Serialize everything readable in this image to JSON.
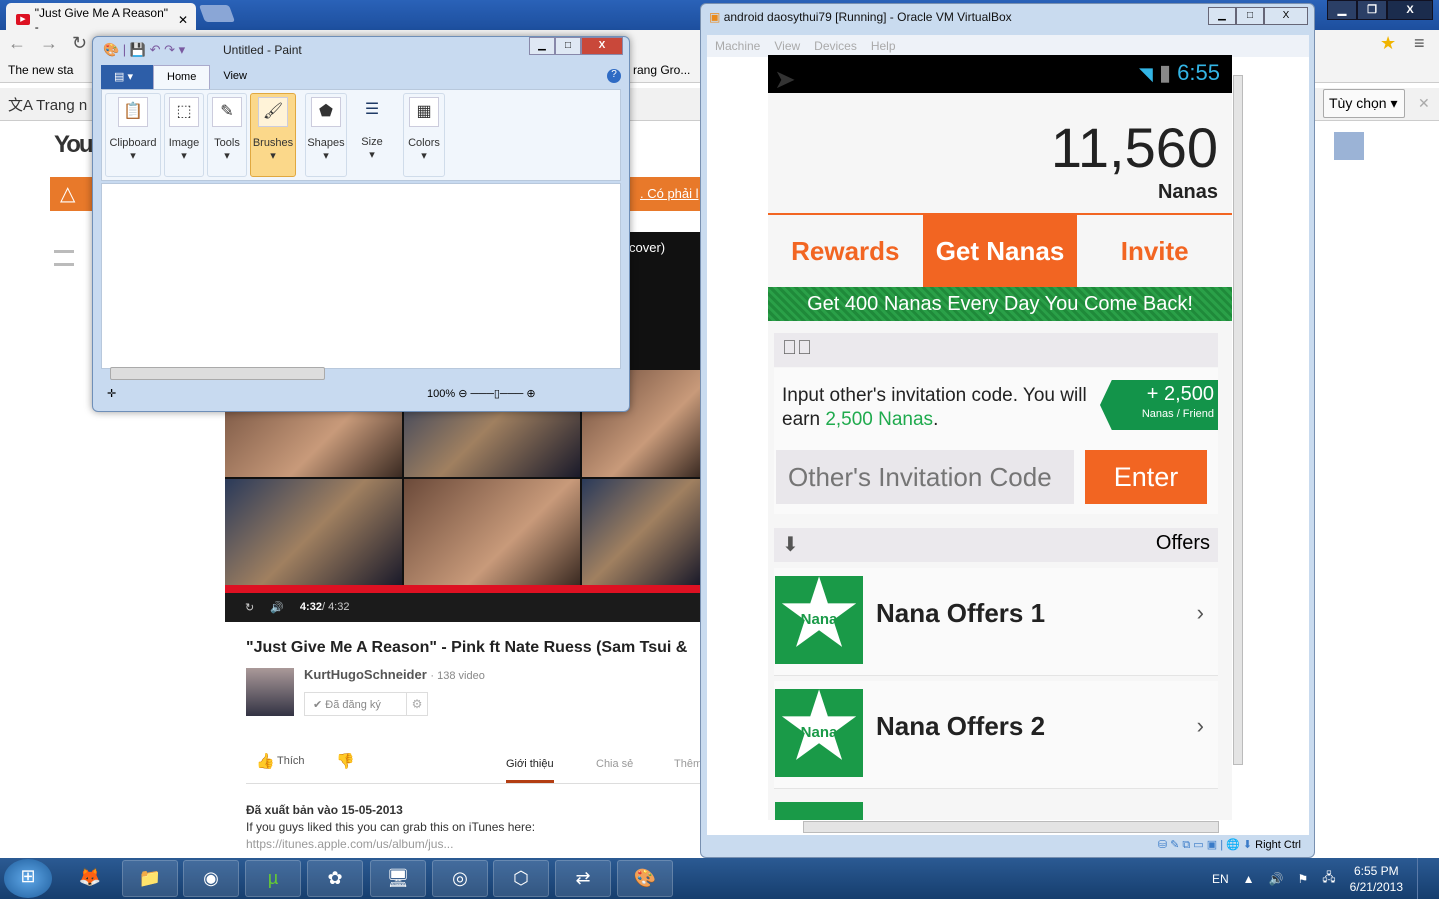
{
  "chrome": {
    "tab_title": "\"Just Give Me A Reason\" -",
    "bookmark": "The new sta",
    "bookmark_right": "rang Gro...",
    "translate_text": "Trang n",
    "translate_options": "Tùy chọn ▾",
    "page_banner_link": ". Có phải l",
    "window_buttons": [
      "▁",
      "❐",
      "X"
    ]
  },
  "youtube": {
    "logo": "You",
    "player_label": "cover)",
    "time_current": "4:32",
    "time_total": "/ 4:32",
    "video_title": "\"Just Give Me A Reason\" - Pink ft Nate Ruess (Sam Tsui &",
    "channel": "KurtHugoSchneider",
    "video_count": "· 138 video",
    "subscribed": "✔  Đã đăng ký",
    "like": "Thích",
    "tabs": [
      "Giới thiệu",
      "Chia sẻ",
      "Thêm"
    ],
    "published": "Đã xuất bản vào 15-05-2013",
    "desc_line": "If you guys liked this you can grab this on iTunes here:",
    "desc_link": "https://itunes.apple.com/us/album/jus..."
  },
  "paint": {
    "title": "Untitled - Paint",
    "tabs": [
      "Home",
      "View"
    ],
    "groups": [
      "Clipboard",
      "Image",
      "Tools",
      "Brushes",
      "Shapes",
      "Size",
      "Colors"
    ],
    "zoom": "100%"
  },
  "vbox": {
    "title": "android daosythui79 [Running] - Oracle VM VirtualBox",
    "menu": [
      "Machine",
      "View",
      "Devices",
      "Help"
    ],
    "host_key": "Right Ctrl"
  },
  "android": {
    "time": "6:55",
    "balance": "11,560",
    "unit": "Nanas",
    "tabs": [
      "Rewards",
      "Get Nanas",
      "Invite"
    ],
    "active_tab": "Get Nanas",
    "banner": "Get 400 Nanas Every Day You Come Back!",
    "invite_text": "Input other's invitation code. You will earn ",
    "invite_amount": "2,500 Nanas",
    "badge_amount": "+ 2,500",
    "badge_sub": "Nanas / Friend",
    "code_placeholder": "Other's Invitation Code",
    "enter": "Enter",
    "offers_header": "Offers",
    "star_label": "Nana",
    "offers": [
      "Nana Offers 1",
      "Nana Offers 2"
    ]
  },
  "taskbar": {
    "lang": "EN",
    "time": "6:55 PM",
    "date": "6/21/2013"
  }
}
